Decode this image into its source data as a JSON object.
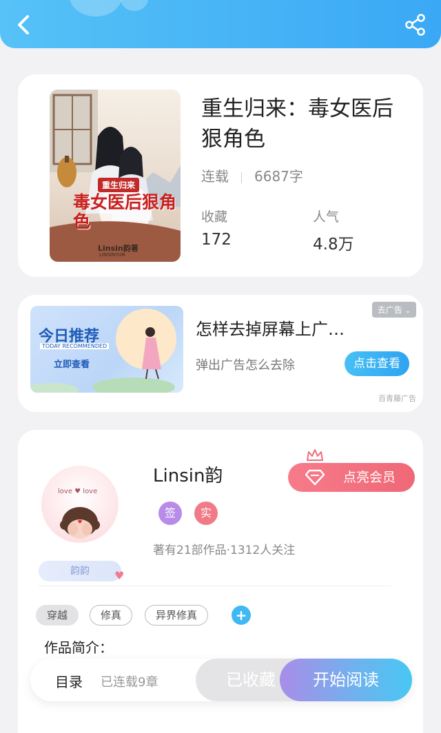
{
  "header": {
    "back_icon": "chevron-left-icon",
    "share_icon": "share-icon",
    "accent": "#3aa8f5"
  },
  "book": {
    "title": "重生归来：毒女医后狠角色",
    "cover_title": "重生归来",
    "cover_big_text": "毒女医后狠角色",
    "cover_author": "Linsin韵著",
    "cover_pinyin": "LINSINYUN",
    "status": "连载",
    "word_count": "6687字",
    "favorites_label": "收藏",
    "favorites_value": "172",
    "popularity_label": "人气",
    "popularity_value": "4.8万"
  },
  "ad": {
    "image_title": "今日推荐",
    "image_subtitle": "TODAY RECOMMENDED",
    "image_button": "立即查看",
    "title": "怎样去掉屏幕上广…",
    "subtitle": "弹出广告怎么去除",
    "remove_label": "去广告",
    "action_label": "点击查看",
    "source": "百青藤广告"
  },
  "author": {
    "avatar_text": "love ♥ love",
    "tag_label": "韵韵",
    "name": "Linsin韵",
    "vip_label": "点亮会员",
    "badges": [
      {
        "label": "签",
        "color": "#b88be8"
      },
      {
        "label": "实",
        "color": "#f07b86"
      }
    ],
    "works_text": "著有21部作品·1312人关注"
  },
  "genre_tags": [
    {
      "label": "穿越",
      "style": "filled"
    },
    {
      "label": "修真",
      "style": "outline"
    },
    {
      "label": "异界修真",
      "style": "outline"
    }
  ],
  "add_tag_label": "+",
  "intro_label": "作品简介：",
  "bottom_bar": {
    "toc_label": "目录",
    "toc_info": "已连载9章",
    "favorited_label": "已收藏",
    "read_label": "开始阅读"
  }
}
